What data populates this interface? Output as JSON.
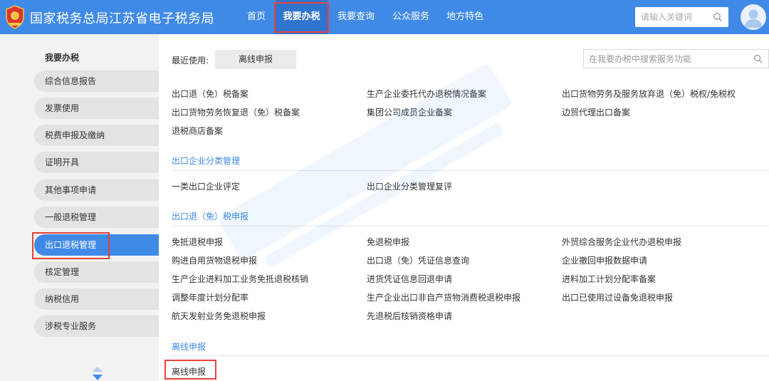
{
  "header": {
    "site_title": "国家税务总局江苏省电子税务局",
    "nav": [
      "首页",
      "我要办税",
      "我要查询",
      "公众服务",
      "地方特色"
    ],
    "search_placeholder": "请输入关键词"
  },
  "sidebar": {
    "title": "我要办税",
    "items": [
      "综合信息报告",
      "发票使用",
      "税费申报及缴纳",
      "证明开具",
      "其他事项申请",
      "一般退税管理",
      "出口退税管理",
      "核定管理",
      "纳税信用",
      "涉税专业服务"
    ],
    "active_index": 6
  },
  "main": {
    "recent_label": "最近使用:",
    "recent_tag": "离线申报",
    "search_placeholder": "在我要办税中搜索服务功能",
    "top_links": [
      "出口退（免）税备案",
      "生产企业委托代办退税情况备案",
      "出口货物劳务及服务放弃退（免）税权/免税权",
      "出口货物劳务恢复退（免）税备案",
      "集团公司成员企业备案",
      "边贸代理出口备案",
      "退税商店备案"
    ],
    "sections": [
      {
        "title": "出口企业分类管理",
        "links": [
          "一类出口企业评定",
          "出口企业分类管理复评"
        ]
      },
      {
        "title": "出口退（免）税申报",
        "links": [
          "免抵退税申报",
          "免退税申报",
          "外贸综合服务企业代办退税申报",
          "购进自用货物退税申报",
          "出口退（免）凭证信息查询",
          "企业撤回申报数据申请",
          "生产企业进料加工业务免抵退税核销",
          "进货凭证信息回退申请",
          "进料加工计划分配率备案",
          "调整年度计划分配率",
          "生产企业出口非自产货物消费税退税申报",
          "出口已使用过设备免退税申报",
          "航天发射业务免退税申报",
          "先退税后核销资格申请"
        ]
      },
      {
        "title": "离线申报",
        "links": [
          "离线申报"
        ]
      }
    ]
  },
  "colors": {
    "header_blue": "#3f8ae6",
    "highlight_red": "#e8403a",
    "section_blue": "#3f8ae6"
  }
}
